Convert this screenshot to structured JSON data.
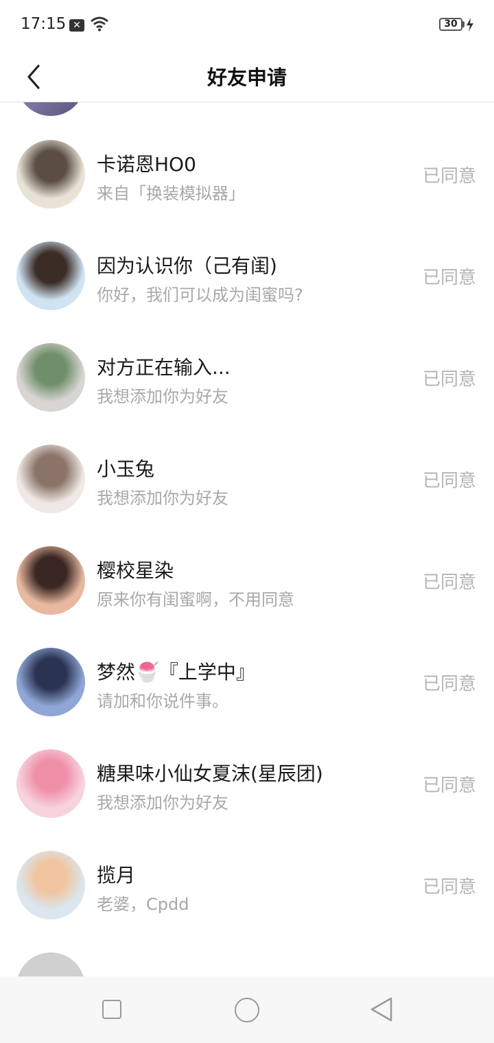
{
  "status_bar": {
    "time": "17:15",
    "battery": "30"
  },
  "header": {
    "title": "好友申请"
  },
  "requests": [
    {
      "name": "卡诺恩HO0",
      "message": "来自「换装模拟器」",
      "status": "已同意",
      "avatar_colors": [
        "#e9e3d6",
        "#5a4d44"
      ]
    },
    {
      "name": "因为认识你（己有闺)",
      "message": "你好，我们可以成为闺蜜吗?",
      "status": "已同意",
      "avatar_colors": [
        "#cfe3f2",
        "#3b2c26"
      ]
    },
    {
      "name": "对方正在输入...",
      "message": "我想添加你为好友",
      "status": "已同意",
      "avatar_colors": [
        "#d9d5d3",
        "#6f8f6a"
      ]
    },
    {
      "name": "小玉兔",
      "message": "我想添加你为好友",
      "status": "已同意",
      "avatar_colors": [
        "#efe8e4",
        "#8a7368"
      ]
    },
    {
      "name": "樱校星染",
      "message": "原来你有闺蜜啊，不用同意",
      "status": "已同意",
      "avatar_colors": [
        "#e8b9a0",
        "#3a2622"
      ]
    },
    {
      "name": "梦然🍧『上学中』",
      "message": "请加和你说件事。",
      "status": "已同意",
      "avatar_colors": [
        "#8fa6d6",
        "#2a3352"
      ]
    },
    {
      "name": "糖果味小仙女夏沫(星辰团)",
      "message": "我想添加你为好友",
      "status": "已同意",
      "avatar_colors": [
        "#f7d3dc",
        "#ef8fa8"
      ]
    },
    {
      "name": "揽月",
      "message": "老婆，Cpdd",
      "status": "已同意",
      "avatar_colors": [
        "#dbe6ee",
        "#f0c5a0"
      ]
    }
  ]
}
